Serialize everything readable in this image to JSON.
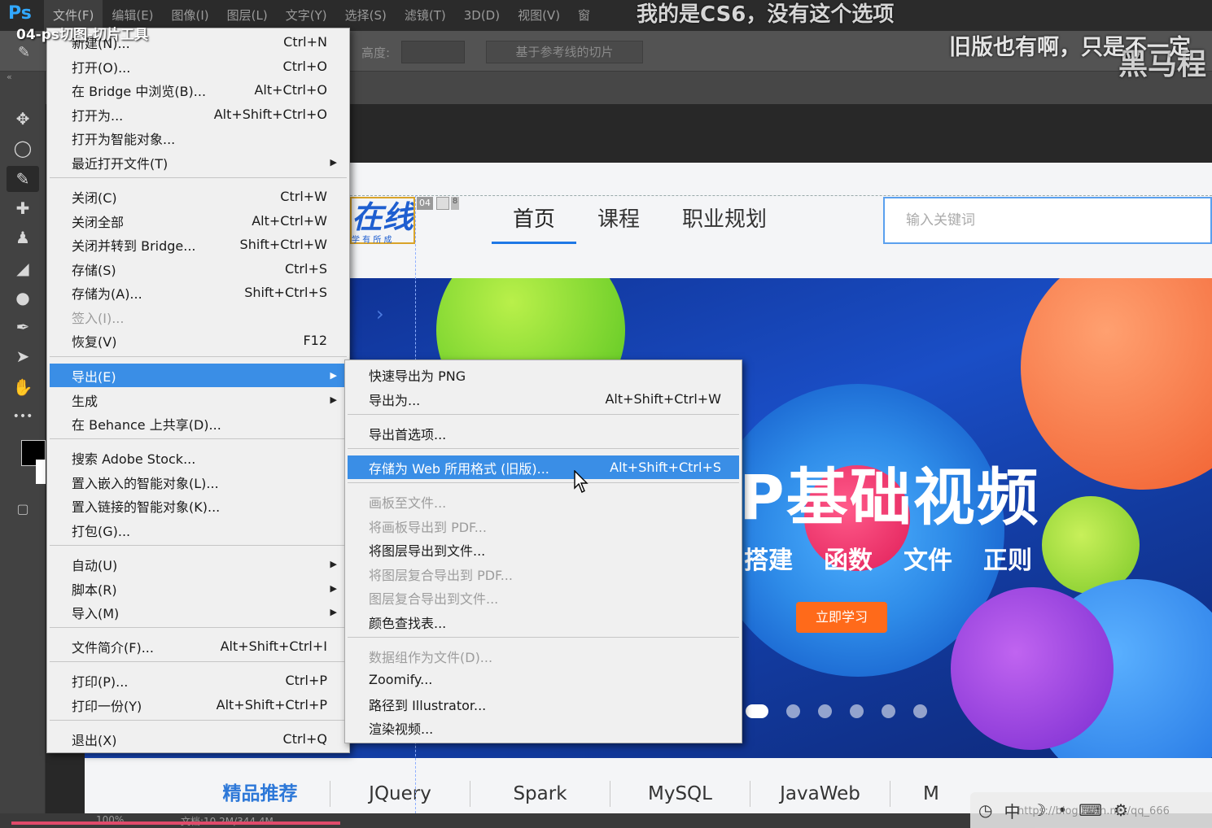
{
  "app": {
    "logo": "Ps"
  },
  "menubar": {
    "items": [
      "文件(F)",
      "编辑(E)",
      "图像(I)",
      "图层(L)",
      "文字(Y)",
      "选择(S)",
      "滤镜(T)",
      "3D(D)",
      "视图(V)",
      "窗"
    ]
  },
  "video_title": "04-ps切图-切片工具",
  "captions": {
    "line1": "我的是CS6，没有这个选项",
    "line2": "旧版也有啊，只是不一定",
    "line3": "黑马程"
  },
  "options_bar": {
    "height_label": "高度:",
    "slice_button": "基于参考线的切片"
  },
  "toolbar": {
    "collapse": "«",
    "tools": [
      {
        "icon": "move-icon",
        "glyph": "✥"
      },
      {
        "icon": "lasso-icon",
        "glyph": "◯"
      },
      {
        "icon": "slice-icon",
        "glyph": "✎"
      },
      {
        "icon": "healing-icon",
        "glyph": "✚"
      },
      {
        "icon": "stamp-icon",
        "glyph": "♟"
      },
      {
        "icon": "eraser-icon",
        "glyph": "◢"
      },
      {
        "icon": "blur-icon",
        "glyph": "●"
      },
      {
        "icon": "pen-icon",
        "glyph": "✒"
      },
      {
        "icon": "path-select-icon",
        "glyph": "➤"
      },
      {
        "icon": "hand-icon",
        "glyph": "✋"
      },
      {
        "icon": "more-icon",
        "glyph": "•••"
      }
    ]
  },
  "file_menu": {
    "items": [
      {
        "label": "新建(N)...",
        "shortcut": "Ctrl+N"
      },
      {
        "label": "打开(O)...",
        "shortcut": "Ctrl+O"
      },
      {
        "label": "在 Bridge 中浏览(B)...",
        "shortcut": "Alt+Ctrl+O"
      },
      {
        "label": "打开为...",
        "shortcut": "Alt+Shift+Ctrl+O"
      },
      {
        "label": "打开为智能对象...",
        "shortcut": ""
      },
      {
        "label": "最近打开文件(T)",
        "shortcut": "",
        "submenu": true
      },
      {
        "label": "关闭(C)",
        "shortcut": "Ctrl+W"
      },
      {
        "label": "关闭全部",
        "shortcut": "Alt+Ctrl+W"
      },
      {
        "label": "关闭并转到 Bridge...",
        "shortcut": "Shift+Ctrl+W"
      },
      {
        "label": "存储(S)",
        "shortcut": "Ctrl+S"
      },
      {
        "label": "存储为(A)...",
        "shortcut": "Shift+Ctrl+S"
      },
      {
        "label": "签入(I)...",
        "shortcut": "",
        "disabled": true
      },
      {
        "label": "恢复(V)",
        "shortcut": "F12"
      },
      {
        "label": "导出(E)",
        "shortcut": "",
        "submenu": true,
        "highlighted": true
      },
      {
        "label": "生成",
        "shortcut": "",
        "submenu": true
      },
      {
        "label": "在 Behance 上共享(D)...",
        "shortcut": ""
      },
      {
        "label": "搜索 Adobe Stock...",
        "shortcut": ""
      },
      {
        "label": "置入嵌入的智能对象(L)...",
        "shortcut": ""
      },
      {
        "label": "置入链接的智能对象(K)...",
        "shortcut": ""
      },
      {
        "label": "打包(G)...",
        "shortcut": ""
      },
      {
        "label": "自动(U)",
        "shortcut": "",
        "submenu": true
      },
      {
        "label": "脚本(R)",
        "shortcut": "",
        "submenu": true
      },
      {
        "label": "导入(M)",
        "shortcut": "",
        "submenu": true
      },
      {
        "label": "文件简介(F)...",
        "shortcut": "Alt+Shift+Ctrl+I"
      },
      {
        "label": "打印(P)...",
        "shortcut": "Ctrl+P"
      },
      {
        "label": "打印一份(Y)",
        "shortcut": "Alt+Shift+Ctrl+P"
      },
      {
        "label": "退出(X)",
        "shortcut": "Ctrl+Q"
      }
    ]
  },
  "export_submenu": {
    "items": [
      {
        "label": "快速导出为 PNG",
        "shortcut": ""
      },
      {
        "label": "导出为...",
        "shortcut": "Alt+Shift+Ctrl+W"
      },
      {
        "label": "导出首选项...",
        "shortcut": ""
      },
      {
        "label": "存储为 Web 所用格式 (旧版)...",
        "shortcut": "Alt+Shift+Ctrl+S",
        "highlighted": true
      },
      {
        "label": "画板至文件...",
        "shortcut": "",
        "disabled": true
      },
      {
        "label": "将画板导出到 PDF...",
        "shortcut": "",
        "disabled": true
      },
      {
        "label": "将图层导出到文件...",
        "shortcut": ""
      },
      {
        "label": "将图层复合导出到 PDF...",
        "shortcut": "",
        "disabled": true
      },
      {
        "label": "图层复合导出到文件...",
        "shortcut": "",
        "disabled": true
      },
      {
        "label": "颜色查找表...",
        "shortcut": ""
      },
      {
        "label": "数据组作为文件(D)...",
        "shortcut": "",
        "disabled": true
      },
      {
        "label": "Zoomify...",
        "shortcut": ""
      },
      {
        "label": "路径到 Illustrator...",
        "shortcut": ""
      },
      {
        "label": "渲染视频...",
        "shortcut": ""
      }
    ]
  },
  "site": {
    "logo_text": "在线",
    "logo_sub": "学 有 所 成",
    "slice_badge": "04",
    "nav": [
      "首页",
      "课程",
      "职业规划"
    ],
    "search_placeholder": "输入关键词",
    "banner": {
      "headline": "P基础视频",
      "topics": [
        "搭建",
        "函数",
        "文件",
        "正则"
      ],
      "cta": "立即学习",
      "dot_count": 6
    },
    "tabs": [
      "精品推荐",
      "JQuery",
      "Spark",
      "MySQL",
      "JavaWeb",
      "M"
    ]
  },
  "statusbar": {
    "zoom": "100%",
    "doc": "文档:10.2M/344.4M"
  },
  "tray": {
    "ime": "中"
  },
  "watermark": "https://blog.csdn.net/qq_666"
}
